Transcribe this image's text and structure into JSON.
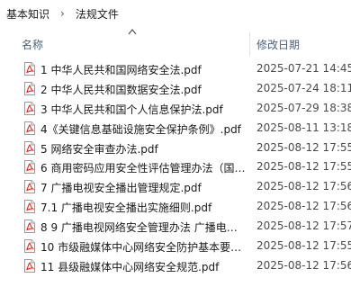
{
  "breadcrumb": {
    "root": "基本知识",
    "separator": "›",
    "current": "法规文件"
  },
  "columns": {
    "name": "名称",
    "modified": "修改日期"
  },
  "files": [
    {
      "name": "1 中华人民共和国网络安全法.pdf",
      "modified": "2025-07-21 14:45"
    },
    {
      "name": "2 中华人民共和国数据安全法.pdf",
      "modified": "2025-07-24 18:11"
    },
    {
      "name": "3 中华人民共和国个人信息保护法.pdf",
      "modified": "2025-07-29 18:38"
    },
    {
      "name": "4《关键信息基础设施安全保护条例》.pdf",
      "modified": "2025-08-11 13:18"
    },
    {
      "name": "5 网络安全审查办法.pdf",
      "modified": "2025-08-12 17:55"
    },
    {
      "name": "6 商用密码应用安全性评估管理办法（国…",
      "modified": "2025-08-12 17:55"
    },
    {
      "name": "7 广播电视安全播出管理规定.pdf",
      "modified": "2025-08-12 17:56"
    },
    {
      "name": "7.1 广播电视安全播出实施细则.pdf",
      "modified": "2025-08-12 17:56"
    },
    {
      "name": "8 9 广播电视网络安全管理办法 广播电…",
      "modified": "2025-08-12 17:57"
    },
    {
      "name": "10 市级融媒体中心网络安全防护基本要…",
      "modified": "2025-08-12 17:55"
    },
    {
      "name": "11 县级融媒体中心网络安全规范.pdf",
      "modified": "2025-08-12 17:56"
    }
  ],
  "icons": {
    "file": "pdf-file-icon",
    "sort": "sort-ascending-icon"
  },
  "colors": {
    "header_text": "#4d6078",
    "pdf_red": "#e0241b"
  }
}
